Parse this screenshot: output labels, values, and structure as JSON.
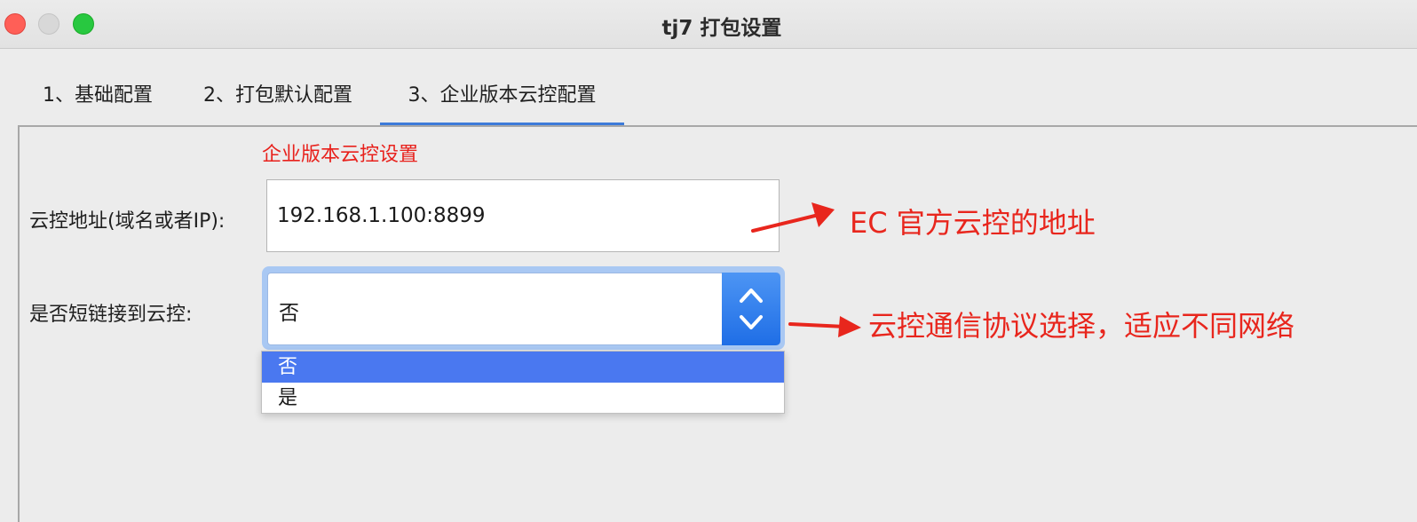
{
  "window": {
    "title": "tj7 打包设置"
  },
  "tabs": [
    {
      "label": "1、基础配置",
      "active": false
    },
    {
      "label": "2、打包默认配置",
      "active": false
    },
    {
      "label": "3、企业版本云控配置",
      "active": true
    }
  ],
  "form": {
    "section_title": "企业版本云控设置",
    "address_label": "云控地址(域名或者IP):",
    "address_value": "192.168.1.100:8899",
    "shortlink_label": "是否短链接到云控:",
    "shortlink_value": "否",
    "shortlink_options": [
      {
        "label": "否",
        "selected": true
      },
      {
        "label": "是",
        "selected": false
      }
    ]
  },
  "annotations": {
    "address_note": "EC 官方云控的地址",
    "protocol_note": "云控通信协议选择，适应不同网络"
  },
  "colors": {
    "annotation": "#e8261d",
    "tab_underline": "#3d7bd9",
    "selection": "#4a78f0"
  }
}
